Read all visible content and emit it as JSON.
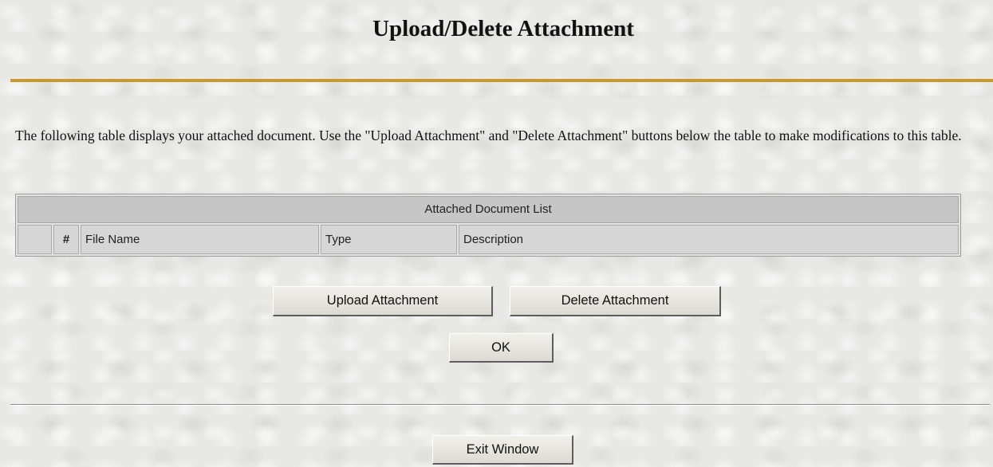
{
  "page": {
    "title": "Upload/Delete Attachment",
    "intro": "The following table displays your attached document.  Use the \"Upload Attachment\" and \"Delete Attachment\" buttons below the table to make modifications to this table."
  },
  "table": {
    "caption": "Attached Document List",
    "columns": {
      "select": "",
      "num": "#",
      "file_name": "File Name",
      "type": "Type",
      "description": "Description"
    }
  },
  "buttons": {
    "upload": "Upload Attachment",
    "delete": "Delete Attachment",
    "ok": "OK",
    "exit": "Exit Window"
  },
  "colors": {
    "accent_rule": "#c9992e",
    "background": "#e8e8e4",
    "table_header": "#c6c6c6"
  }
}
